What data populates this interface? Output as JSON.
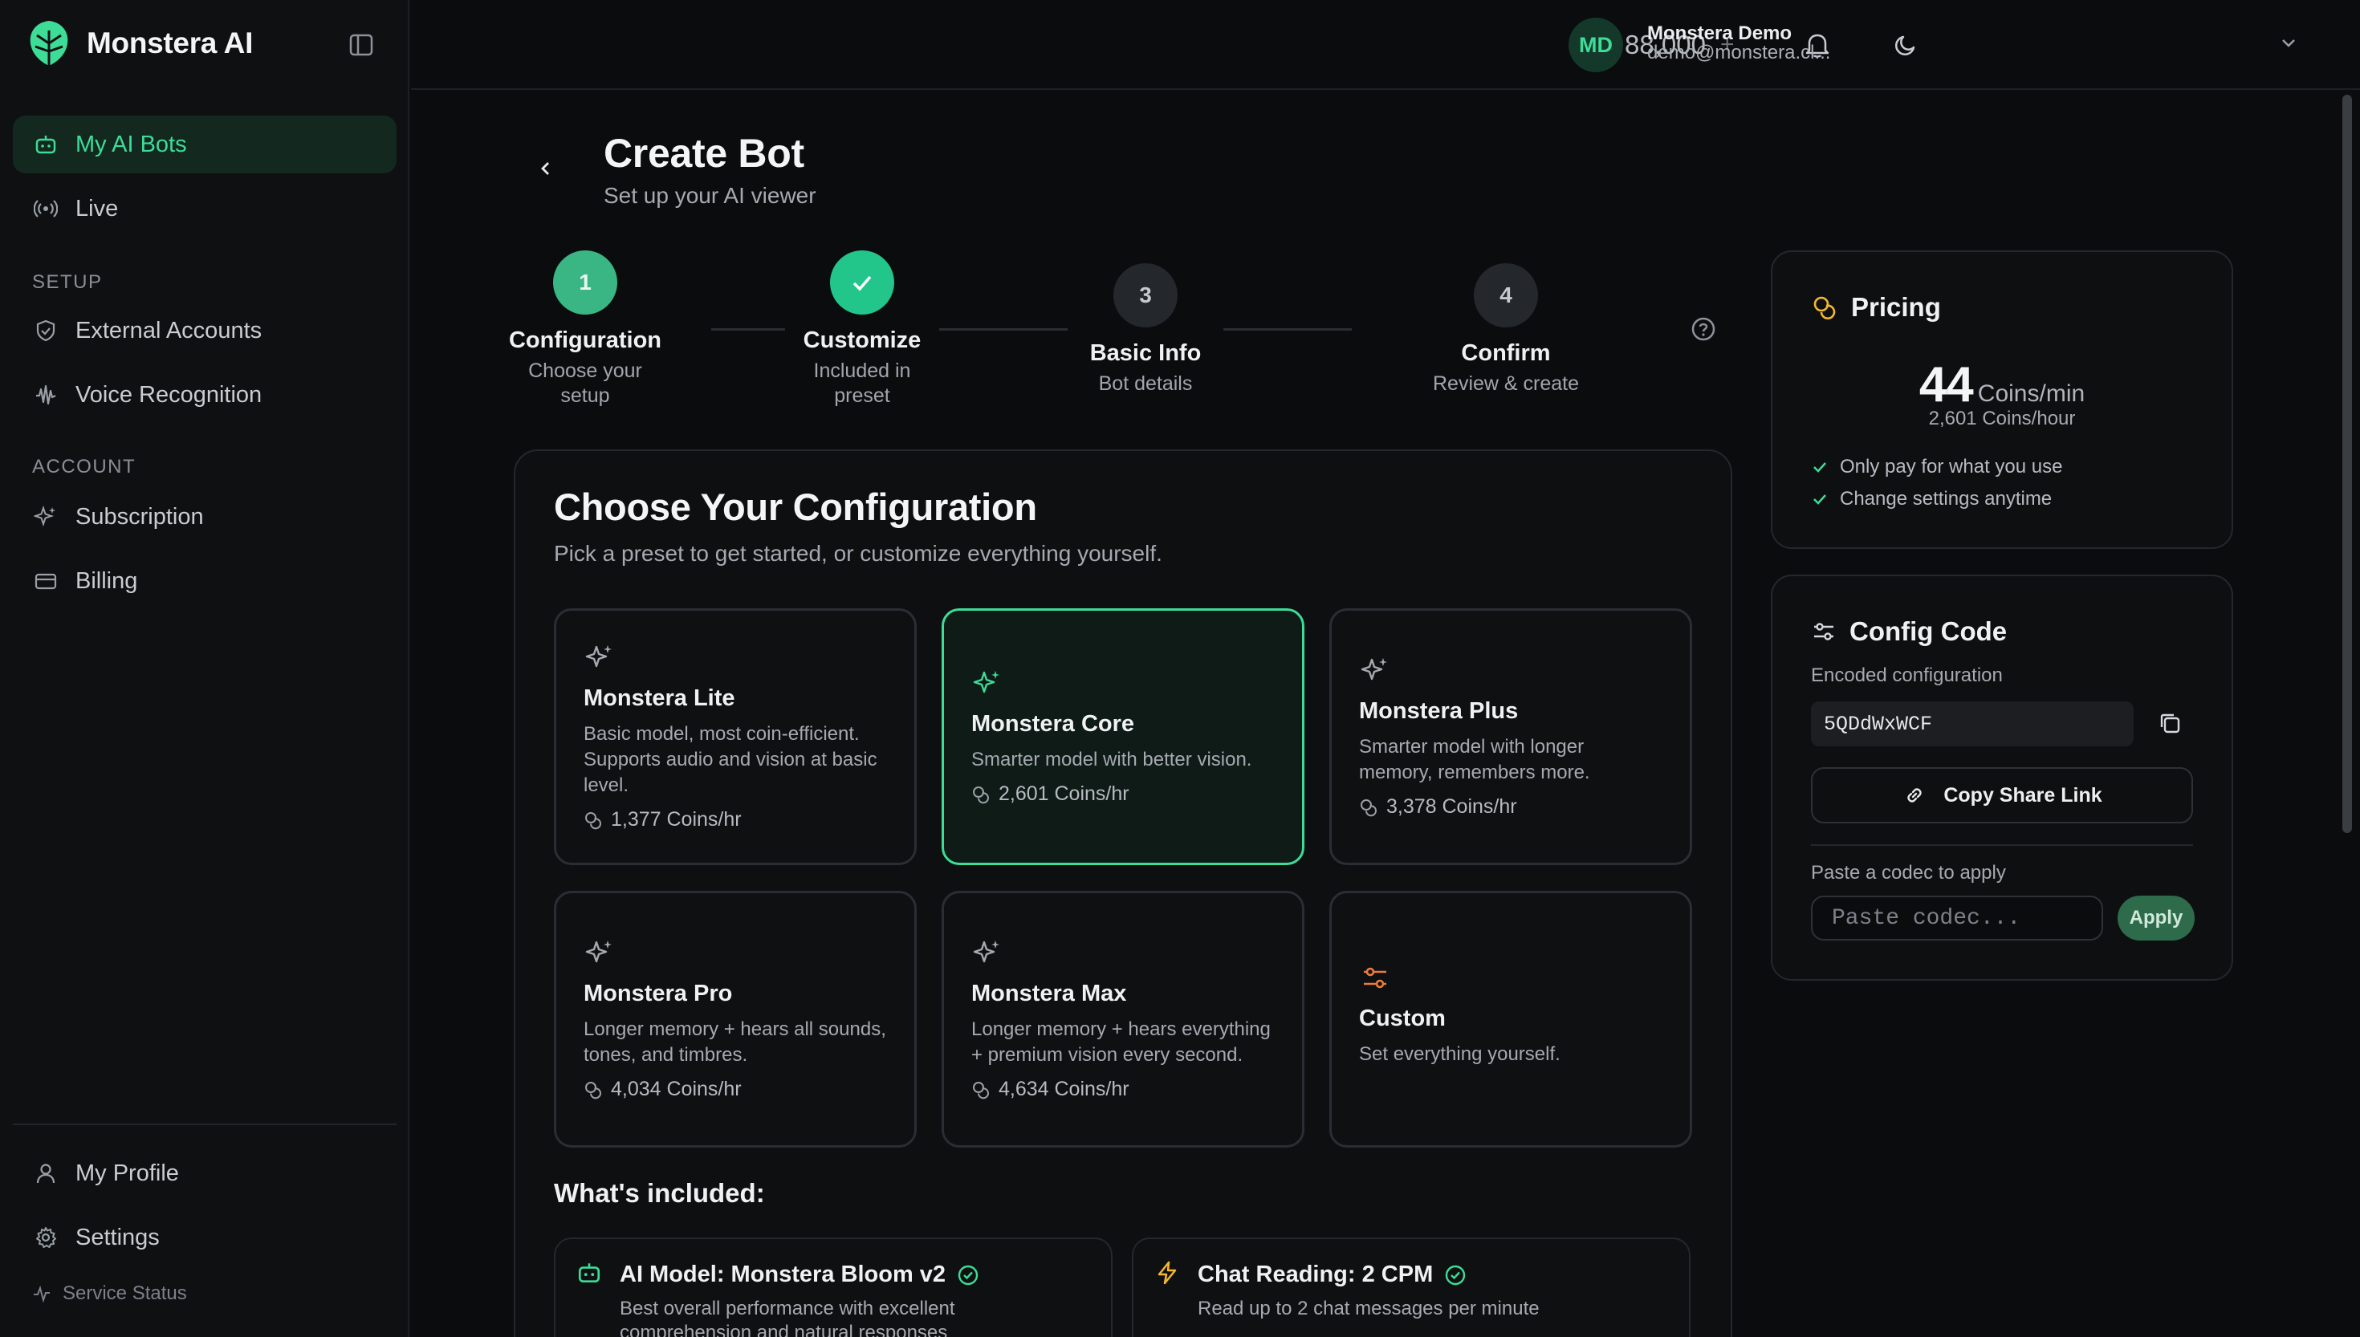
{
  "brand": {
    "name": "Monstera AI"
  },
  "sidebar": {
    "items": [
      {
        "label": "My AI Bots"
      },
      {
        "label": "Live"
      },
      {
        "label": "External Accounts"
      },
      {
        "label": "Voice Recognition"
      },
      {
        "label": "Subscription"
      },
      {
        "label": "Billing"
      },
      {
        "label": "My Profile"
      },
      {
        "label": "Settings"
      }
    ],
    "sections": {
      "setup": "SETUP",
      "account": "ACCOUNT"
    },
    "service_status": "Service Status"
  },
  "topbar": {
    "coins": "88,000",
    "plus": "+",
    "user": {
      "initials": "MD",
      "name": "Monstera Demo",
      "email": "demo@monstera.cl..."
    }
  },
  "page": {
    "title": "Create Bot",
    "subtitle": "Set up your AI viewer"
  },
  "stepper": [
    {
      "number": "1",
      "title": "Configuration",
      "desc": "Choose your setup",
      "state": "active"
    },
    {
      "number": "",
      "title": "Customize",
      "desc": "Included in preset",
      "state": "done"
    },
    {
      "number": "3",
      "title": "Basic Info",
      "desc": "Bot details",
      "state": "pending"
    },
    {
      "number": "4",
      "title": "Confirm",
      "desc": "Review & create",
      "state": "pending"
    }
  ],
  "config": {
    "title": "Choose Your Configuration",
    "subtitle": "Pick a preset to get started, or customize everything yourself.",
    "presets": [
      {
        "name": "Monstera Lite",
        "desc": "Basic model, most coin-efficient. Supports audio and vision at basic level.",
        "cost": "1,377 Coins/hr"
      },
      {
        "name": "Monstera Core",
        "desc": "Smarter model with better vision.",
        "cost": "2,601 Coins/hr",
        "selected": true
      },
      {
        "name": "Monstera Plus",
        "desc": "Smarter model with longer memory, remembers more.",
        "cost": "3,378 Coins/hr"
      },
      {
        "name": "Monstera Pro",
        "desc": "Longer memory + hears all sounds, tones, and timbres.",
        "cost": "4,034 Coins/hr"
      },
      {
        "name": "Monstera Max",
        "desc": "Longer memory + hears everything + premium vision every second.",
        "cost": "4,634 Coins/hr"
      },
      {
        "name": "Custom",
        "desc": "Set everything yourself.",
        "cost": ""
      }
    ],
    "included_title": "What's included:",
    "included": [
      {
        "title": "AI Model: Monstera Bloom v2",
        "desc": "Best overall performance with excellent comprehension and natural responses"
      },
      {
        "title": "Chat Reading: 2 CPM",
        "desc": "Read up to 2 chat messages per minute"
      }
    ]
  },
  "pricing": {
    "title": "Pricing",
    "value": "44",
    "unit": "Coins/min",
    "hourly": "2,601 Coins/hour",
    "checks": [
      "Only pay for what you use",
      "Change settings anytime"
    ]
  },
  "config_code": {
    "title": "Config Code",
    "label": "Encoded configuration",
    "code": "5QDdWxWCF",
    "share_label": "Copy Share Link",
    "paste_label": "Paste a codec to apply",
    "paste_placeholder": "Paste codec...",
    "apply_label": "Apply"
  },
  "colors": {
    "accent": "#3ddc97",
    "accent_step": "#22c58a",
    "warning": "#f5b731",
    "custom": "#f07a3a"
  }
}
